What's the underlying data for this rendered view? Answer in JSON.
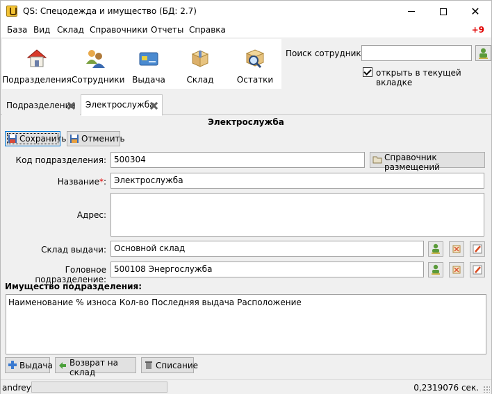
{
  "window": {
    "title": "QS: Спецодежда и имущество (БД: 2.7)"
  },
  "menu": {
    "items": [
      "База",
      "Вид",
      "Склад",
      "Справочники",
      "Отчеты",
      "Справка"
    ],
    "badge": "+9"
  },
  "toolbar": {
    "buttons": [
      {
        "label": "Подразделения",
        "icon": "house-icon"
      },
      {
        "label": "Сотрудники",
        "icon": "people-icon"
      },
      {
        "label": "Выдача",
        "icon": "card-icon"
      },
      {
        "label": "Склад",
        "icon": "box-icon"
      },
      {
        "label": "Остатки",
        "icon": "magnifier-box-icon"
      }
    ]
  },
  "search": {
    "label": "Поиск сотрудника:",
    "value": "",
    "checkbox_label": "открыть в текущей вкладке",
    "checked": true
  },
  "tabs": [
    {
      "label": "Подразделения",
      "active": false
    },
    {
      "label": "Электрослужба",
      "active": true
    }
  ],
  "form": {
    "title": "Электрослужба",
    "save_label": "Сохранить",
    "cancel_label": "Отменить",
    "code_label": "Код подразделения:",
    "code_value": "500304",
    "placement_button": "Справочник размещений",
    "name_label": "Название",
    "name_required": "*",
    "name_colon": ":",
    "name_value": "Электрослужба",
    "address_label": "Адрес:",
    "address_value": "",
    "warehouse_label": "Склад выдачи:",
    "warehouse_value": "Основной склад",
    "parent_label": "Головное подразделение:",
    "parent_value": "500108 Энергослужба"
  },
  "property": {
    "title": "Имущество подразделения:",
    "columns": [
      "Наименование",
      "% износа",
      "Кол-во",
      "Последняя выдача",
      "Расположение"
    ],
    "rows": [],
    "issue_button": "Выдача",
    "return_button": "Возврат на склад",
    "writeoff_button": "Списание"
  },
  "status": {
    "user": "andrey",
    "time": "0,2319076 сек."
  },
  "colors": {
    "accent": "#0078d7",
    "badge": "#e00000"
  }
}
